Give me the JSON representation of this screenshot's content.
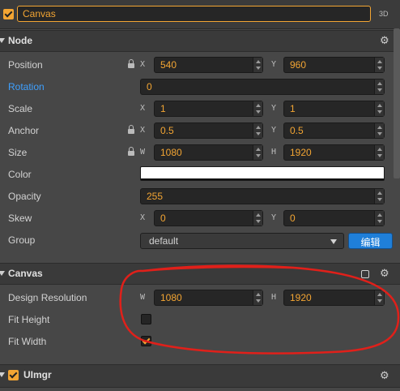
{
  "node": {
    "name": "Canvas",
    "mode_3d": "3D",
    "active": true
  },
  "node_section": {
    "title": "Node",
    "position": {
      "label": "Position",
      "x_axis": "X",
      "x": "540",
      "y_axis": "Y",
      "y": "960"
    },
    "rotation": {
      "label": "Rotation",
      "value": "0"
    },
    "scale": {
      "label": "Scale",
      "x_axis": "X",
      "x": "1",
      "y_axis": "Y",
      "y": "1"
    },
    "anchor": {
      "label": "Anchor",
      "x_axis": "X",
      "x": "0.5",
      "y_axis": "Y",
      "y": "0.5"
    },
    "size": {
      "label": "Size",
      "w_axis": "W",
      "w": "1080",
      "h_axis": "H",
      "h": "1920"
    },
    "color": {
      "label": "Color",
      "value": "#ffffff"
    },
    "opacity": {
      "label": "Opacity",
      "value": "255"
    },
    "skew": {
      "label": "Skew",
      "x_axis": "X",
      "x": "0",
      "y_axis": "Y",
      "y": "0"
    },
    "group": {
      "label": "Group",
      "value": "default",
      "edit_label": "编辑"
    }
  },
  "canvas_section": {
    "title": "Canvas",
    "design_resolution": {
      "label": "Design Resolution",
      "w_axis": "W",
      "w": "1080",
      "h_axis": "H",
      "h": "1920"
    },
    "fit_height": {
      "label": "Fit Height",
      "checked": false
    },
    "fit_width": {
      "label": "Fit Width",
      "checked": true
    }
  },
  "uimgr_section": {
    "title": "UImgr",
    "enabled": true
  },
  "colors": {
    "accent": "#f3a533",
    "link": "#3ea0ff",
    "button": "#1f7fd9",
    "annotation": "#e0201a"
  }
}
